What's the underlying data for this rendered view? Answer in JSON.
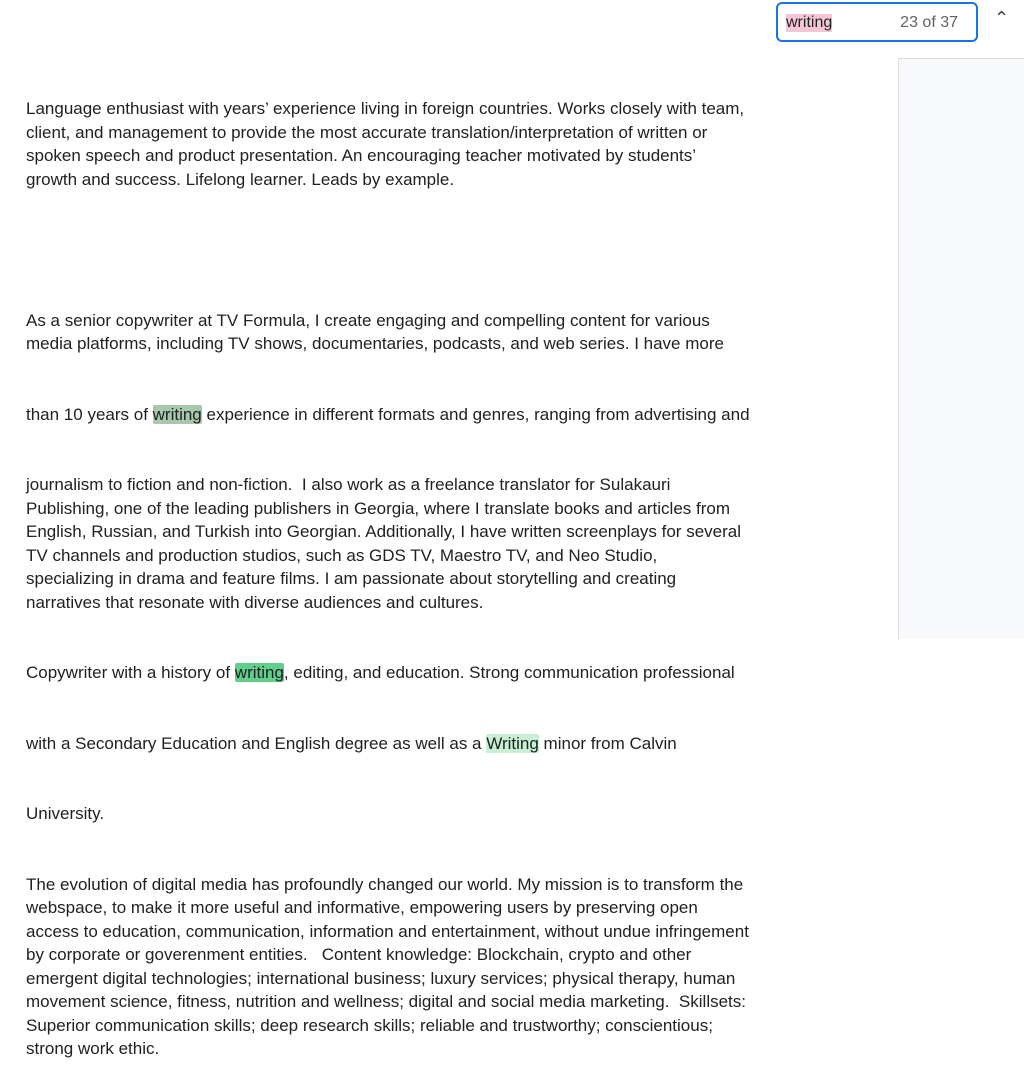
{
  "find": {
    "query": "writing",
    "count": "23 of 37",
    "prev_icon": "chevron-up-icon"
  },
  "highlight_colors": {
    "match": "#a8c8ac",
    "active": "#5fcf8a",
    "other": "#c9f0d4",
    "query": "#f7c6d6"
  },
  "doc": {
    "p1": [
      "Language enthusiast with years’ experience living in foreign countries. Works closely with team,",
      "client, and management to provide the most accurate translation/interpretation of written or",
      "spoken speech and product presentation. An encouraging teacher motivated by students’",
      "growth and success. Lifelong learner. Leads by example."
    ],
    "p2a": [
      "As a senior copywriter at TV Formula, I create engaging and compelling content for various",
      "media platforms, including TV shows, documentaries, podcasts, and web series. I have more"
    ],
    "p2_hl": {
      "before": "than 10 years of ",
      "match": "writing",
      "after": " experience in different formats and genres, ranging from advertising and"
    },
    "p2b": [
      "journalism to fiction and non-fiction.  I also work as a freelance translator for Sulakauri",
      "Publishing, one of the leading publishers in Georgia, where I translate books and articles from",
      "English, Russian, and Turkish into Georgian. Additionally, I have written screenplays for several",
      "TV channels and production studios, such as GDS TV, Maestro TV, and Neo Studio,",
      "specializing in drama and feature films. I am passionate about storytelling and creating",
      "narratives that resonate with diverse audiences and cultures."
    ],
    "p3_l1": {
      "before": "Copywriter with a history of ",
      "match": "writing",
      "after": ", editing, and education. Strong communication professional"
    },
    "p3_l2": {
      "before": "with a Secondary Education and English degree as well as a ",
      "match": "Writing",
      "after": " minor from Calvin"
    },
    "p3_l3": "University.",
    "p4": [
      "The evolution of digital media has profoundly changed our world. My mission is to transform the",
      "webspace, to make it more useful and informative, empowering users by preserving open",
      "access to education, communication, information and entertainment, without undue infringement",
      "by corporate or goverenment entities.   Content knowledge: Blockchain, crypto and other",
      "emergent digital technologies; international business; luxury services; physical therapy, human",
      "movement science, fitness, nutrition and wellness; digital and social media marketing.  Skillsets:",
      "Superior communication skills; deep research skills; reliable and trustworthy; conscientious;",
      "strong work ethic."
    ]
  }
}
